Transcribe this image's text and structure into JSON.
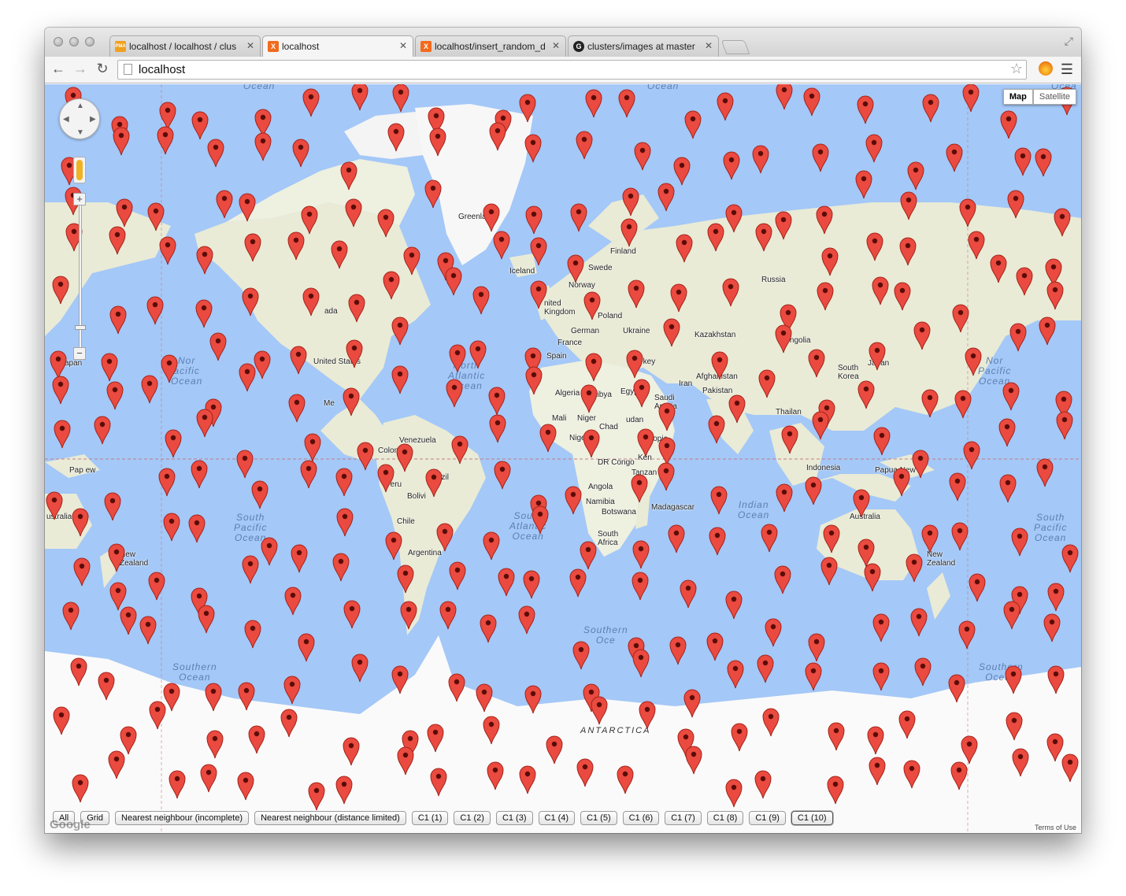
{
  "browser": {
    "tabs": [
      {
        "label": "localhost / localhost / clus",
        "favicon": "phpmyadmin-icon",
        "active": false
      },
      {
        "label": "localhost",
        "favicon": "xampp-icon",
        "active": true
      },
      {
        "label": "localhost/insert_random_d",
        "favicon": "xampp-icon",
        "active": false
      },
      {
        "label": "clusters/images at master",
        "favicon": "github-icon",
        "active": false
      }
    ],
    "address": "localhost",
    "favicon_text": {
      "pma": "PMA",
      "x": "X",
      "gh": "G"
    }
  },
  "map": {
    "type_control": {
      "map_label": "Map",
      "satellite_label": "Satellite",
      "selected": "Map"
    },
    "zoom": {
      "plus": "+",
      "minus": "−"
    },
    "labels": {
      "greenland": "Greenland",
      "iceland": "Iceland",
      "finland": "Finland",
      "sweden": "Swede",
      "norway": "Norway",
      "uk": "nited\nKingdom",
      "poland": "Poland",
      "germany": "German",
      "ukraine": "Ukraine",
      "france": "France",
      "spain": "Spain",
      "turkey": "Turkey",
      "russia": "Russia",
      "kazakhstan": "Kazakhstan",
      "mongolia": "Mongolia",
      "afghanistan": "Afghanistan",
      "pakistan": "Pakistan",
      "iran": "Iran",
      "saudi": "Saudi\nArabia",
      "egypt": "Egypt",
      "libya": "Libya",
      "algeria": "Algeria",
      "mali": "Mali",
      "niger": "Niger",
      "chad": "Chad",
      "nigeria": "Nigeri",
      "sudan": "udan",
      "ethiopia": "Ethiopia",
      "drc": "DR Congo",
      "kenya": "Ken",
      "tanzania": "Tanzan",
      "angola": "Angola",
      "namibia": "Namibia",
      "botswana": "Botswana",
      "south_africa": "South\nAfrica",
      "madagascar": "Madagascar",
      "thailand": "Thailan",
      "indonesia": "Indonesia",
      "south_korea": "South\nKorea",
      "japan": "Japan",
      "japan_left": "Japan",
      "australia": "Australia",
      "australia_left": "ustralia",
      "new_zealand": "New\nZealand",
      "new_zealand_left": "New\nZealand",
      "png": "Papua New",
      "png_left": "Pap ew",
      "united_states": "United States",
      "canada": "ada",
      "mexico": "Me",
      "venezuela": "Venezuela",
      "colombia": "Colombia",
      "peru": "Peru",
      "brazil": "Brazil",
      "bolivia": "Bolivi",
      "chile": "Chile",
      "argentina": "Argentina",
      "antarctica": "ANTARCTICA"
    },
    "oceans": {
      "north_pacific_left": "Nor\nacific\nOcean",
      "north_pacific_right": "Nor\nPacific\nOcean",
      "north_atlantic": "North\nAtlantic\nOcean",
      "south_pacific_left": "South\nPacific\nOcean",
      "south_pacific_right": "South\nPacific\nOcean",
      "south_atlantic": "South\nAtlantic\nOcean",
      "indian": "Indian\nOcean",
      "southern_left": "Southern\nOcean",
      "southern_mid": "Southern\nOce",
      "southern_right": "Southern\nOcean",
      "arctic_left": "Ocean",
      "arctic_mid": "Ocean",
      "arctic_right": "Ocea"
    },
    "marker_count": 330,
    "marker_color": "#ea4a3f",
    "water_color": "#a4c8f7",
    "land_color": "#e9ebd6",
    "ice_color": "#fafafa"
  },
  "cluster_buttons": [
    {
      "label": "All",
      "selected": false
    },
    {
      "label": "Grid",
      "selected": false
    },
    {
      "label": "Nearest neighbour (incomplete)",
      "selected": false
    },
    {
      "label": "Nearest neighbour (distance limited)",
      "selected": false
    },
    {
      "label": "C1 (1)",
      "selected": false
    },
    {
      "label": "C1 (2)",
      "selected": false
    },
    {
      "label": "C1 (3)",
      "selected": false
    },
    {
      "label": "C1 (4)",
      "selected": false
    },
    {
      "label": "C1 (5)",
      "selected": false
    },
    {
      "label": "C1 (6)",
      "selected": false
    },
    {
      "label": "C1 (7)",
      "selected": false
    },
    {
      "label": "C1 (8)",
      "selected": false
    },
    {
      "label": "C1 (9)",
      "selected": false
    },
    {
      "label": "C1 (10)",
      "selected": true
    }
  ],
  "footer": {
    "terms": "Terms of Use",
    "logo": "Google"
  }
}
